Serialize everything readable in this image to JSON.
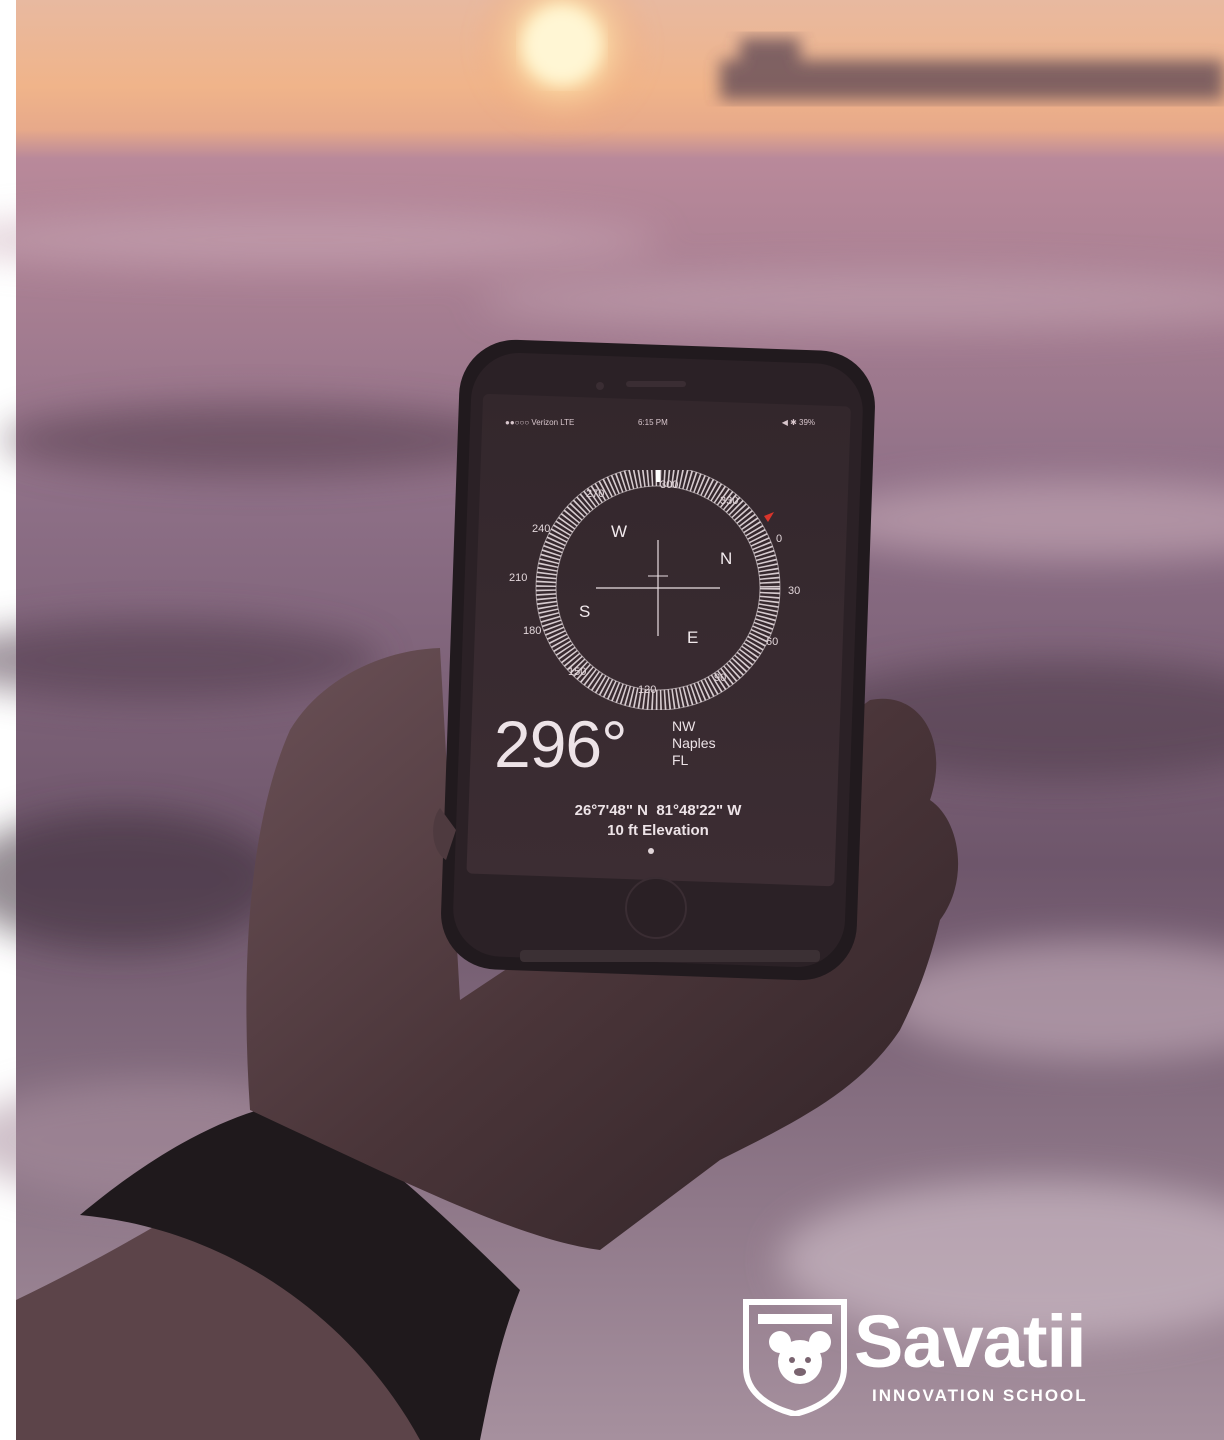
{
  "photo": {
    "description_tag": "hand-holding-phone-compass-at-sunset-beach",
    "colors": {
      "sky": "#e9b48f",
      "sea": "#7d5f78",
      "sun": "#fff3c9",
      "phone": "#2a2227",
      "screen": "#3a2b31",
      "accent_red": "#d9342b",
      "logo": "#ffffff"
    }
  },
  "phone": {
    "status_bar": {
      "carrier": "●●○○○ Verizon  LTE",
      "time": "6:15 PM",
      "battery": "◀ ✱ 39%"
    },
    "compass": {
      "heading_degrees": 296,
      "dial_labels": [
        "270",
        "300",
        "330",
        "0",
        "30",
        "60",
        "90",
        "120",
        "150",
        "180",
        "210",
        "240"
      ],
      "cardinals": {
        "north": "N",
        "east": "E",
        "south": "S",
        "west": "W"
      }
    },
    "reading": {
      "value": "296°",
      "direction": "NW",
      "city": "Naples",
      "state": "FL"
    },
    "coordinates": "26°7'48\" N  81°48'22\" W",
    "elevation": "10 ft Elevation"
  },
  "logo": {
    "brand": "Savatii",
    "subtitle": "INNOVATION SCHOOL"
  }
}
